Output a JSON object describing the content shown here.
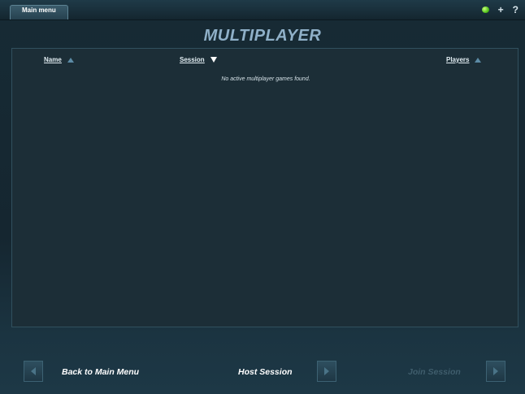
{
  "topbar": {
    "tab_label": "Main menu",
    "icons": [
      "chat-icon",
      "plus-icon",
      "help-icon"
    ],
    "plus_glyph": "+",
    "help_glyph": "?"
  },
  "page": {
    "title": "MULTIPLAYER"
  },
  "list": {
    "columns": [
      {
        "label": "Name",
        "sort": "ascending"
      },
      {
        "label": "Session",
        "sort": "descending"
      },
      {
        "label": "Players",
        "sort": "ascending"
      }
    ],
    "empty_message": "No active multiplayer games found."
  },
  "bottom": {
    "back_label": "Back to Main Menu",
    "host_label": "Host Session",
    "join_label": "Join Session",
    "join_enabled": false
  },
  "colors": {
    "title": "#8fb0c8",
    "background": "#172b35",
    "panel": "#1c2e37",
    "disabled_text": "#3f5d6c",
    "chat_indicator": "#54c21d"
  }
}
